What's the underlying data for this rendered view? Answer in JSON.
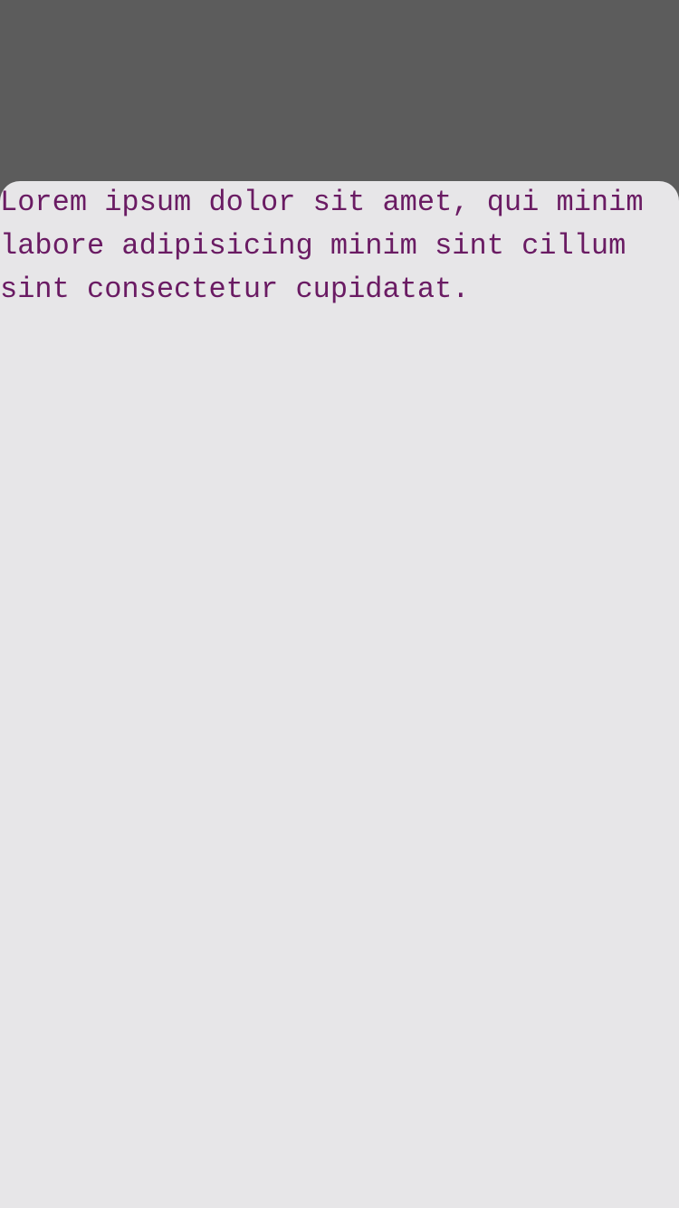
{
  "sheet": {
    "body_text": "Lorem ipsum dolor sit amet, qui minim labore adipisicing minim sint cillum sint consectetur cupidatat."
  },
  "colors": {
    "backdrop": "#5c5c5c",
    "sheet_background": "#e7e6e8",
    "text": "#6a1b63"
  }
}
